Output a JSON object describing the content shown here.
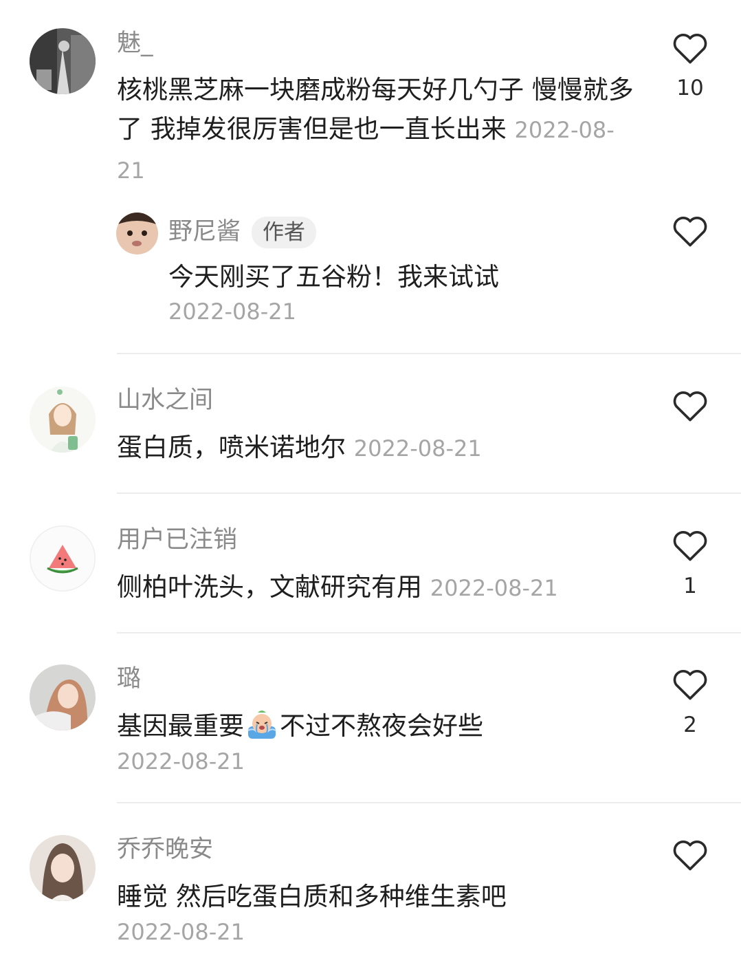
{
  "comments": [
    {
      "username": "魅_",
      "text": "核桃黑芝麻一块磨成粉每天好几勺子  慢慢就多了 我掉发很厉害但是也一直长出来",
      "date": "2022-08-21",
      "likes": "10",
      "avatar": "bw-photo-avatar",
      "reply": {
        "username": "野尼酱",
        "badge": "作者",
        "text": "今天刚买了五谷粉！我来试试",
        "date": "2022-08-21",
        "avatar": "baby-photo-avatar"
      }
    },
    {
      "username": "山水之间",
      "text": "蛋白质，喷米诺地尔",
      "date": "2022-08-21",
      "likes": "",
      "avatar": "illustrated-girl-avatar"
    },
    {
      "username": "用户已注销",
      "text": "侧柏叶洗头，文献研究有用",
      "date": "2022-08-21",
      "likes": "1",
      "avatar": "watermelon-avatar"
    },
    {
      "username": "璐",
      "text_before_emoji": "基因最重要",
      "emoji": "crying-emoji",
      "text_after_emoji": "不过不熬夜会好些",
      "date": "2022-08-21",
      "likes": "2",
      "avatar": "girl-photo-avatar"
    },
    {
      "username": "乔乔晚安",
      "text": "睡觉 然后吃蛋白质和多种维生素吧",
      "date": "2022-08-21",
      "likes": "",
      "avatar": "girl-photo-avatar-2"
    }
  ],
  "colors": {
    "username": "#8a8a8a",
    "date": "#a5a5a5",
    "text": "#1e1e1e",
    "divider": "#ececec",
    "heart_stroke": "#2a2a2a"
  }
}
